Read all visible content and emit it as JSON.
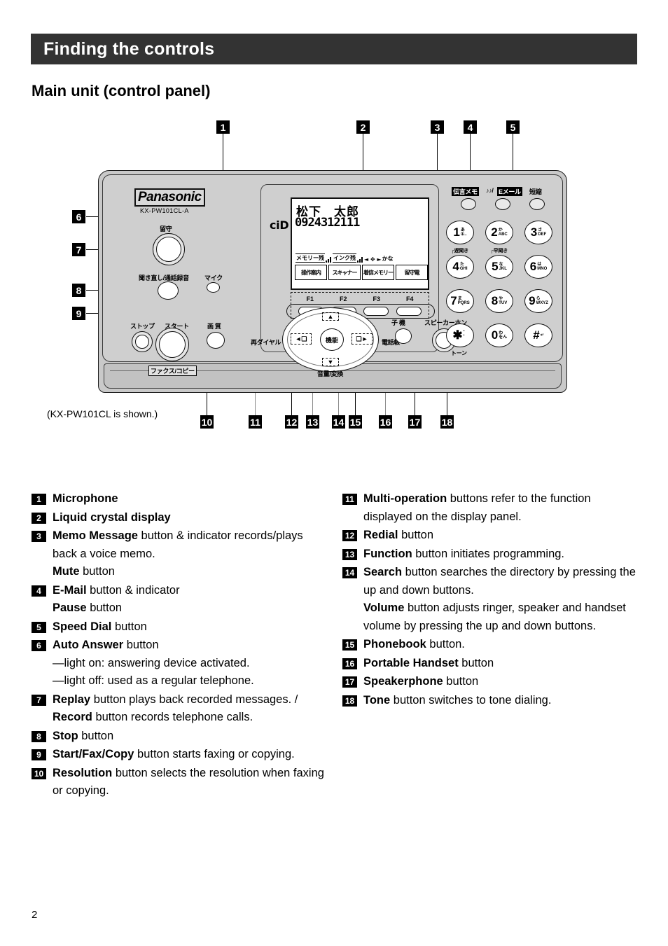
{
  "header": {
    "title": "Finding the controls"
  },
  "section": {
    "title": "Main unit (control panel)"
  },
  "page_number": "2",
  "diagram": {
    "caption": "(KX-PW101CL is shown.)",
    "brand": "Panasonic",
    "model": "KX-PW101CL-A",
    "callouts_top": [
      "1",
      "2",
      "3",
      "4",
      "5"
    ],
    "callouts_left": [
      "6",
      "7",
      "8",
      "9"
    ],
    "callouts_bottom": [
      "10",
      "11",
      "12",
      "13",
      "14",
      "15",
      "16",
      "17",
      "18"
    ],
    "labels": {
      "auto_answer": "留守",
      "replay_record": "聞き直し/通話録音",
      "mic": "マイク",
      "stop": "ストップ",
      "start": "スタート",
      "resolution": "画 質",
      "fax_copy": "ファクス/コピー",
      "memo_message": "伝言メモ",
      "email": "Eメール",
      "email_note": "♪♪/",
      "speed_dial": "短縮",
      "slow_play": "遅聞き",
      "fast_play": "早聞き",
      "tone": "トーン",
      "redial": "再ダイヤル",
      "function": "機能",
      "phonebook": "電話帳",
      "volume": "音量/変換",
      "handset": "子 機",
      "speakerphone": "スピーカーホン"
    },
    "lcd": {
      "cid_icon": "ciD",
      "name": "松下　太郎",
      "number": "0924312111",
      "status_memory": "メモリー残",
      "status_ink": "インク残",
      "status_arrows": "◄ ✥ ► ",
      "status_kana": "かな",
      "softkeys": [
        "操作案内",
        "スキャナー",
        "着信メモリー",
        "留守電"
      ],
      "fkeys": [
        "F1",
        "F2",
        "F3",
        "F4"
      ]
    },
    "keypad": [
      {
        "num": "1",
        "sub1": "あ",
        "sub2": "①.."
      },
      {
        "num": "2",
        "sub1": "か",
        "sub2": "ABC"
      },
      {
        "num": "3",
        "sub1": "さ",
        "sub2": "DEF"
      },
      {
        "num": "4",
        "sub1": "た",
        "sub2": "GHI"
      },
      {
        "num": "5",
        "sub1": "な",
        "sub2": "JKL"
      },
      {
        "num": "6",
        "sub1": "は",
        "sub2": "MNO"
      },
      {
        "num": "7",
        "sub1": "ま",
        "sub2": "PQRS"
      },
      {
        "num": "8",
        "sub1": "や",
        "sub2": "TUV"
      },
      {
        "num": "9",
        "sub1": "ら",
        "sub2": "WXYZ"
      },
      {
        "num": "✱",
        "sub1": "゛",
        "sub2": "゜"
      },
      {
        "num": "0",
        "sub1": "わ",
        "sub2": "をん"
      },
      {
        "num": "#",
        "sub1": "↵",
        "sub2": ""
      }
    ]
  },
  "legend": {
    "left": [
      {
        "num": "1",
        "html": "<b>Microphone</b>"
      },
      {
        "num": "2",
        "html": "<b>Liquid crystal display</b>"
      },
      {
        "num": "3",
        "html": "<b>Memo Message</b> button &amp; indicator records/plays back a voice memo.<br><b>Mute</b> button"
      },
      {
        "num": "4",
        "html": "<b>E-Mail</b> button &amp; indicator<br><b>Pause</b> button"
      },
      {
        "num": "5",
        "html": "<b>Speed Dial</b> button"
      },
      {
        "num": "6",
        "html": "<b>Auto Answer</b> button<br>—light on:  answering device activated.<br>—light off:  used as a regular telephone."
      },
      {
        "num": "7",
        "html": "<b>Replay</b> button plays back recorded messages. / <b>Record</b> button records telephone calls."
      },
      {
        "num": "8",
        "html": "<b>Stop</b> button"
      },
      {
        "num": "9",
        "html": "<b>Start/Fax/Copy</b> button starts faxing or copying."
      },
      {
        "num": "10",
        "html": "<b>Resolution</b> button selects the resolution when faxing or copying."
      }
    ],
    "right": [
      {
        "num": "11",
        "html": "<b>Multi-operation</b> buttons refer to the function displayed on the display panel."
      },
      {
        "num": "12",
        "html": "<b>Redial</b> button"
      },
      {
        "num": "13",
        "html": "<b>Function</b> button initiates programming."
      },
      {
        "num": "14",
        "html": "<b>Search</b> button searches the directory by pressing the up and down buttons.<br><b>Volume</b> button adjusts ringer, speaker and handset volume by pressing the up and down buttons."
      },
      {
        "num": "15",
        "html": "<b>Phonebook</b> button."
      },
      {
        "num": "16",
        "html": "<b>Portable Handset</b> button"
      },
      {
        "num": "17",
        "html": "<b>Speakerphone</b> button"
      },
      {
        "num": "18",
        "html": "<b>Tone</b> button switches to tone dialing."
      }
    ]
  }
}
